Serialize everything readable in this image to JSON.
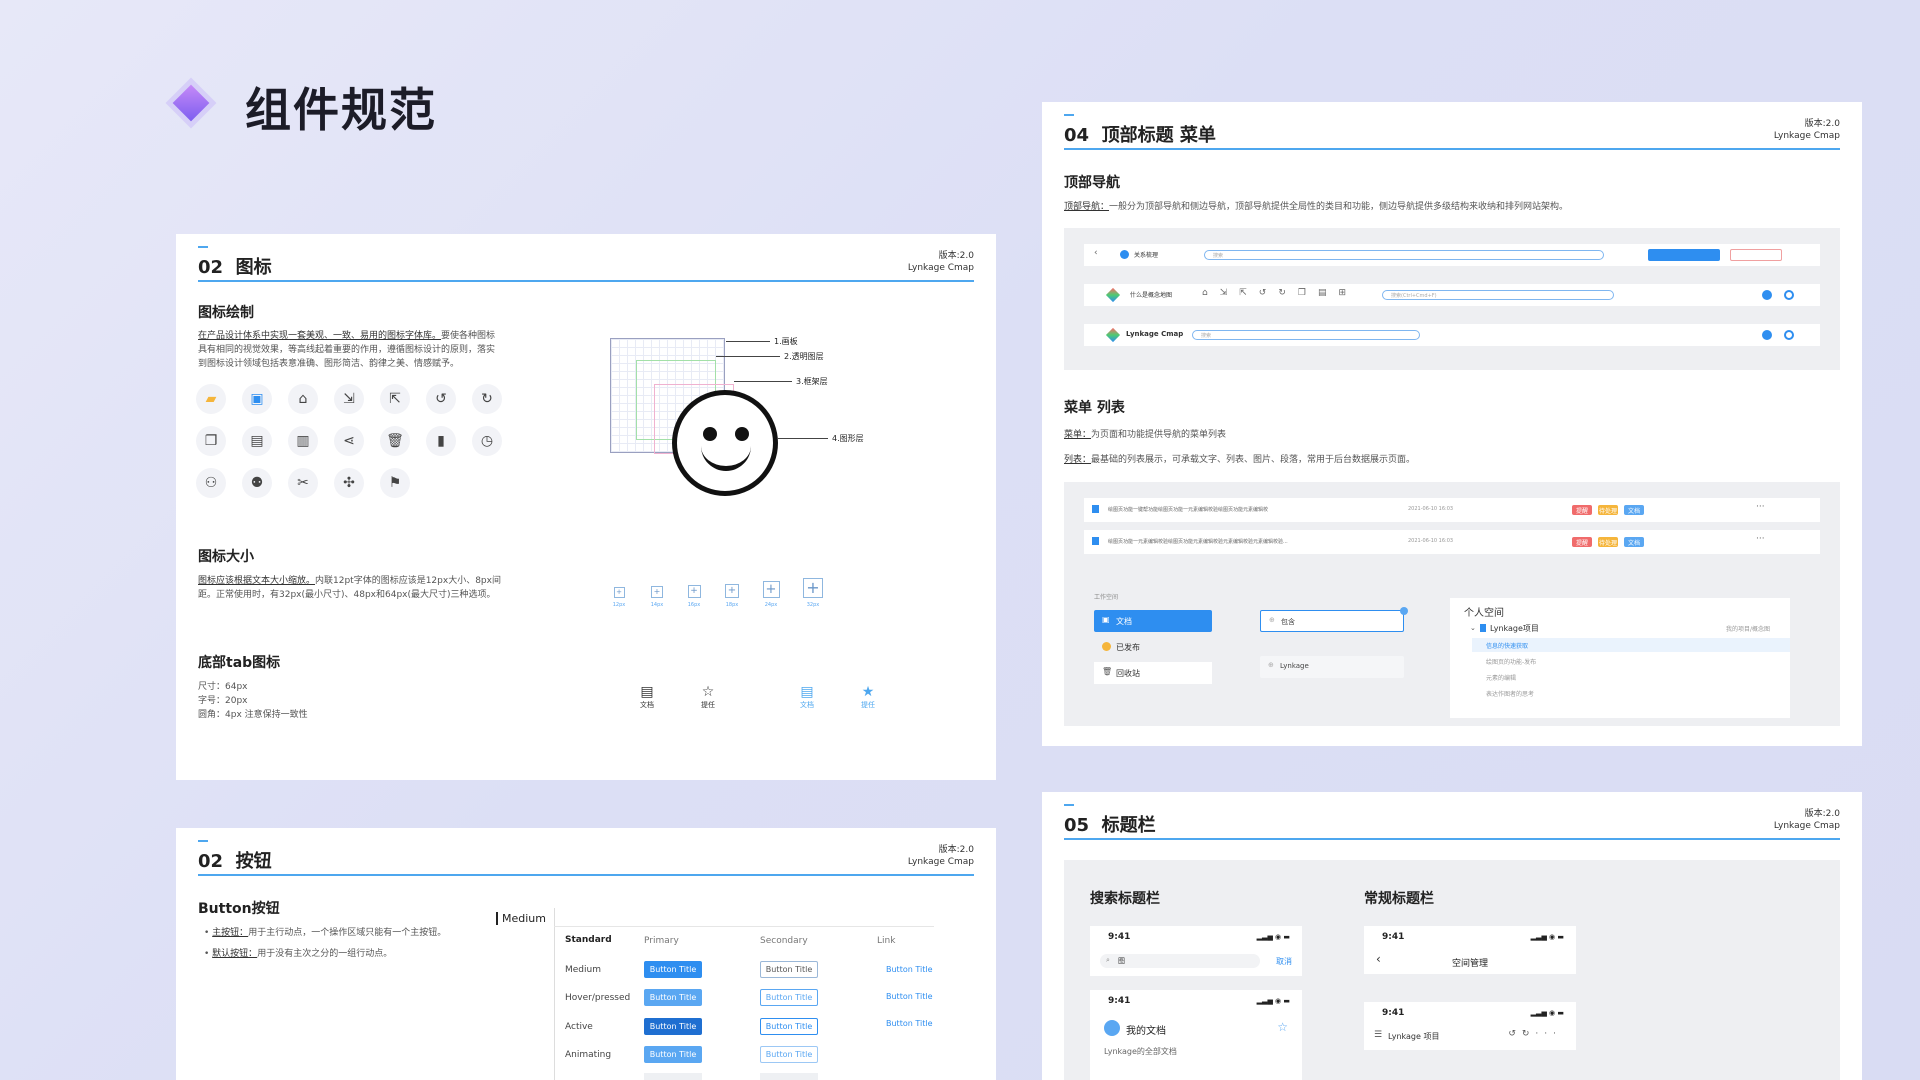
{
  "page": {
    "title": "组件规范"
  },
  "colors": {
    "accent": "#4ea7ef",
    "primary": "#2e8ef0",
    "title_diamond": "#9a6cf4"
  },
  "version": {
    "line1": "版本:2.0",
    "line2": "Lynkage Cmap"
  },
  "icons_panel": {
    "num": "02",
    "title": "图标",
    "drawing_title": "图标绘制",
    "drawing_desc_1": "在产品设计体系中实现一套美观、一致、易用的图标字体库。",
    "drawing_desc_2": "要使各种图标具有相同的视觉效果，等高线起着重要的作用，遵循图标设计的原则，落实到图标设计领域包括表意准确、图形简洁、韵律之美、情感赋予。",
    "layers": [
      "1.画板",
      "2.透明图层",
      "3.框架层",
      "4.图形层"
    ],
    "icon_names": [
      "folder-icon",
      "doc-icon",
      "home-icon",
      "import-icon",
      "export-icon",
      "undo-icon",
      "redo-icon",
      "copy-icon",
      "save-icon",
      "file-icon",
      "share-icon",
      "trash-icon",
      "chart-icon",
      "history-icon",
      "user-icon",
      "users-icon",
      "tools-icon",
      "pin-icon",
      "flag-icon"
    ],
    "icon_glyphs": [
      "▰",
      "▣",
      "⌂",
      "⇲",
      "⇱",
      "↺",
      "↻",
      "❐",
      "▤",
      "▥",
      "⋖",
      "🗑",
      "▮",
      "◷",
      "⚇",
      "⚉",
      "✂",
      "✣",
      "⚑"
    ],
    "size_title": "图标大小",
    "size_desc_1": "图标应该根据文本大小缩放。",
    "size_desc_2": "内联12pt字体的图标应该是12px大小、8px间距。正常使用时，有32px(最小尺寸)、48px和64px(最大尺寸)三种选项。",
    "size_labels": [
      "12px",
      "14px",
      "16px",
      "18px",
      "24px",
      "32px"
    ],
    "tab_title": "底部tab图标",
    "tab_spec_1": "尺寸：64px",
    "tab_spec_2": "字号：20px",
    "tab_spec_3": "圆角：4px   注意保持一致性",
    "tab_labels": [
      "文档",
      "提任",
      "文档",
      "提任"
    ]
  },
  "buttons_panel": {
    "num": "02",
    "title": "按钮",
    "section_title": "Button按钮",
    "bullet_1_label": "主按钮：",
    "bullet_1": "用于主行动点，一个操作区域只能有一个主按钮。",
    "bullet_2_label": "默认按钮：",
    "bullet_2": "用于没有主次之分的一组行动点。",
    "size_tag": "Medium",
    "columns": [
      "Standard",
      "Primary",
      "Secondary",
      "Link"
    ],
    "rows": [
      "Medium",
      "Hover/pressed",
      "Active",
      "Animating"
    ],
    "button_text": "Button Title"
  },
  "nav_panel": {
    "num": "04",
    "title": "顶部标题 菜单",
    "nav_title": "顶部导航",
    "nav_desc_label": "顶部导航：",
    "nav_desc": "一般分为顶部导航和侧边导航，顶部导航提供全局性的类目和功能，侧边导航提供多级结构来收纳和排列网站架构。",
    "row1_label": "关系梳理",
    "row1_search": "搜索",
    "row2_label": "什么是概念地图",
    "row2_search": "搜索(Ctrl+Cmd+F)",
    "row3_label": "Lynkage Cmap",
    "row3_search": "搜索",
    "menu_title": "菜单 列表",
    "menu_desc_label": "菜单：",
    "menu_desc": "为页面和功能提供导航的菜单列表",
    "list_desc_label": "列表：",
    "list_desc": "最基础的列表展示，可承载文字、列表、图片、段落，常用于后台数据展示页面。",
    "list_rows": [
      {
        "text": "绘图页功能一键帮功能绘图页功能一元素编辑校验绘图页功能元素编辑校",
        "date": "2021-06-10  16:03"
      },
      {
        "text": "绘图页功能一元素编辑校验绘图页功能元素编辑校验元素编辑校验元素编辑校验...",
        "date": "2021-06-10  16:03"
      }
    ],
    "tags": [
      "提醒",
      "待处理",
      "文档"
    ],
    "workspace_label": "工作空间",
    "sidebar_items": [
      "文档",
      "已发布",
      "回收站"
    ],
    "mid_items": [
      "包含",
      "Lynkage"
    ],
    "tree_title": "个人空间",
    "tree_root": "Lynkage项目",
    "tree_right": "我的项目/概念图",
    "tree_items": [
      "信息的快速获取",
      "绘图页的功能-发布",
      "元素的编辑",
      "表达作图者的思考"
    ]
  },
  "titlebar_panel": {
    "num": "05",
    "title": "标题栏",
    "search_title": "搜索标题栏",
    "normal_title": "常规标题栏",
    "time": "9:41",
    "search_placeholder": "图",
    "cancel": "取消",
    "mydocs": "我的文档",
    "all_docs": "Lynkage的全部文档",
    "space_mgmt": "空间管理",
    "project": "Lynkage 项目"
  }
}
